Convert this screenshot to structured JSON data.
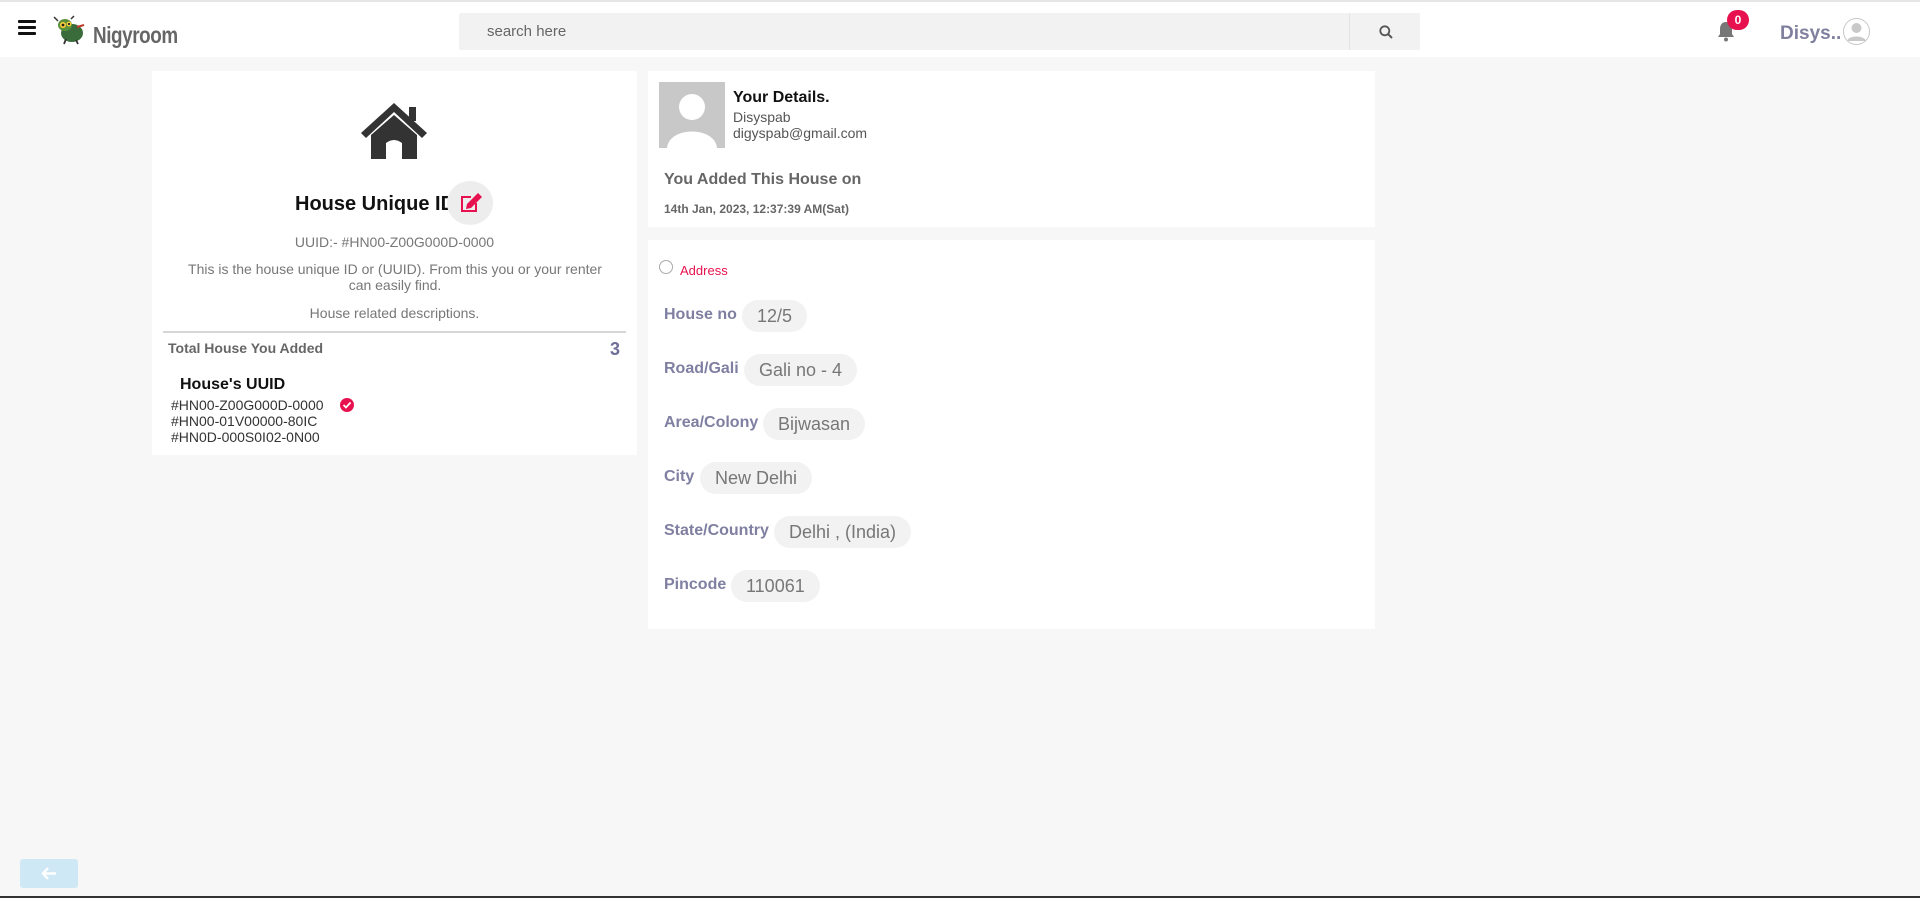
{
  "header": {
    "brand": "Nigyroom",
    "search_placeholder": "search here",
    "notification_count": "0",
    "user_name": "Disys.."
  },
  "house_card": {
    "title": "House Unique ID",
    "uuid_line": "UUID:- #HN00-Z00G000D-0000",
    "description": "This is the house unique ID or (UUID). From this you or your renter can easily find.",
    "description2": "House related descriptions.",
    "total_label": "Total House You Added",
    "total_count": "3",
    "uuids_title": "House's UUID",
    "uuids": [
      "#HN00-Z00G000D-0000",
      "#HN00-01V00000-80IC",
      "#HN0D-000S0I02-0N00"
    ]
  },
  "details": {
    "title": "Your Details.",
    "name": "Disyspab",
    "email": "digyspab@gmail.com",
    "added_label": "You Added This House on",
    "added_date": "14th Jan, 2023, 12:37:39 AM(Sat)"
  },
  "address": {
    "label": "Address",
    "rows": [
      {
        "label": "House no",
        "value": "12/5"
      },
      {
        "label": "Road/Gali",
        "value": "Gali no - 4"
      },
      {
        "label": "Area/Colony",
        "value": "Bijwasan"
      },
      {
        "label": "City",
        "value": "New Delhi"
      },
      {
        "label": "State/Country",
        "value": "Delhi , (India)"
      },
      {
        "label": "Pincode",
        "value": "110061"
      }
    ]
  },
  "colors": {
    "accent": "#e8114f",
    "label": "#7f7fa2",
    "back_button": "#cfe8f5"
  },
  "icons": [
    "menu-icon",
    "logo-icon",
    "search-icon",
    "bell-icon",
    "user-avatar-icon",
    "house-icon",
    "edit-icon",
    "check-circle-icon",
    "person-placeholder-icon",
    "arrow-left-icon"
  ]
}
